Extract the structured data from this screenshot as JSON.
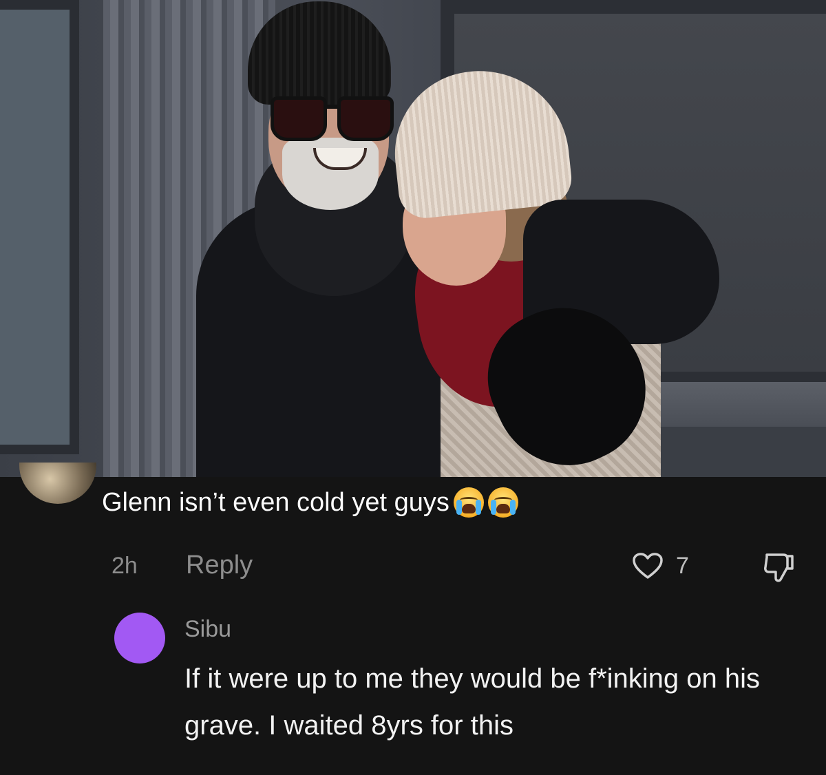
{
  "comment": {
    "text": "Glenn isn’t even cold yet guys",
    "emojis": [
      "loudly-crying-face-icon",
      "loudly-crying-face-icon"
    ],
    "time": "2h",
    "reply_label": "Reply",
    "like_count": "7"
  },
  "reply": {
    "username": "Sibu",
    "text": "If it were up to me they would be f*inking on his grave. I waited 8yrs for this",
    "avatar_color": "#a259f3"
  },
  "colors": {
    "background": "#141414",
    "muted_text": "#8d8d8d",
    "accent_avatar": "#a259f3"
  }
}
